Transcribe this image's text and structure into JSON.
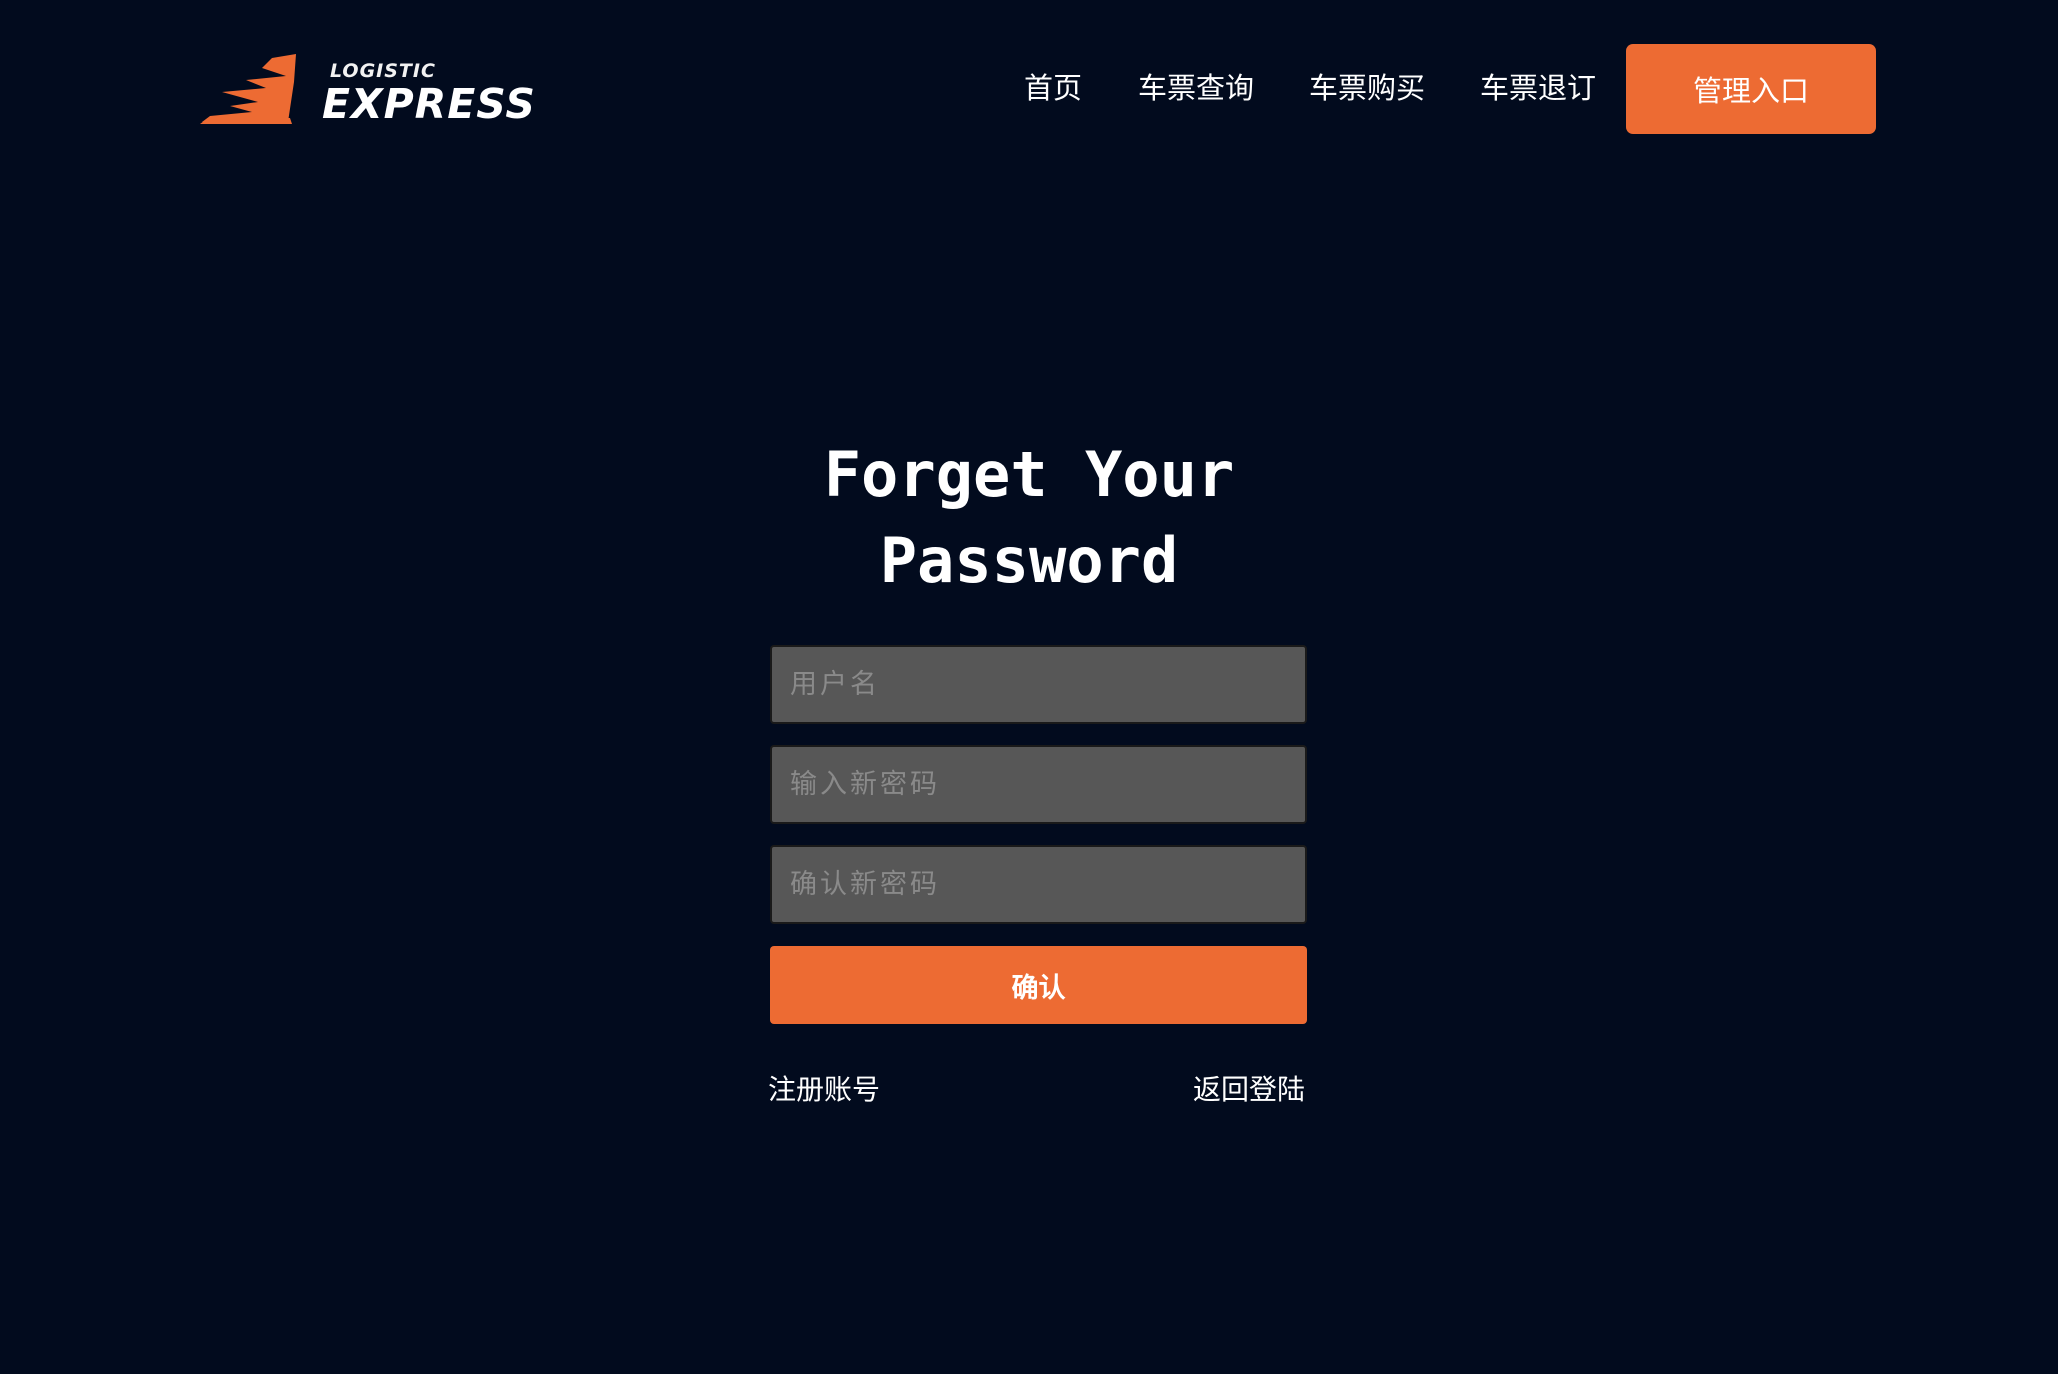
{
  "brand": {
    "small": "LOGISTIC",
    "name": "EXPRESS",
    "accent_color": "#ed6b33",
    "background_color": "#020b1e"
  },
  "nav": {
    "items": [
      {
        "label": "首页"
      },
      {
        "label": "车票查询"
      },
      {
        "label": "车票购买"
      },
      {
        "label": "车票退订"
      }
    ],
    "admin_label": "管理入口"
  },
  "form": {
    "title_line1": "Forget Your",
    "title_line2": "Password",
    "username_placeholder": "用户名",
    "new_password_placeholder": "输入新密码",
    "confirm_password_placeholder": "确认新密码",
    "submit_label": "确认",
    "register_link": "注册账号",
    "back_link": "返回登陆"
  }
}
